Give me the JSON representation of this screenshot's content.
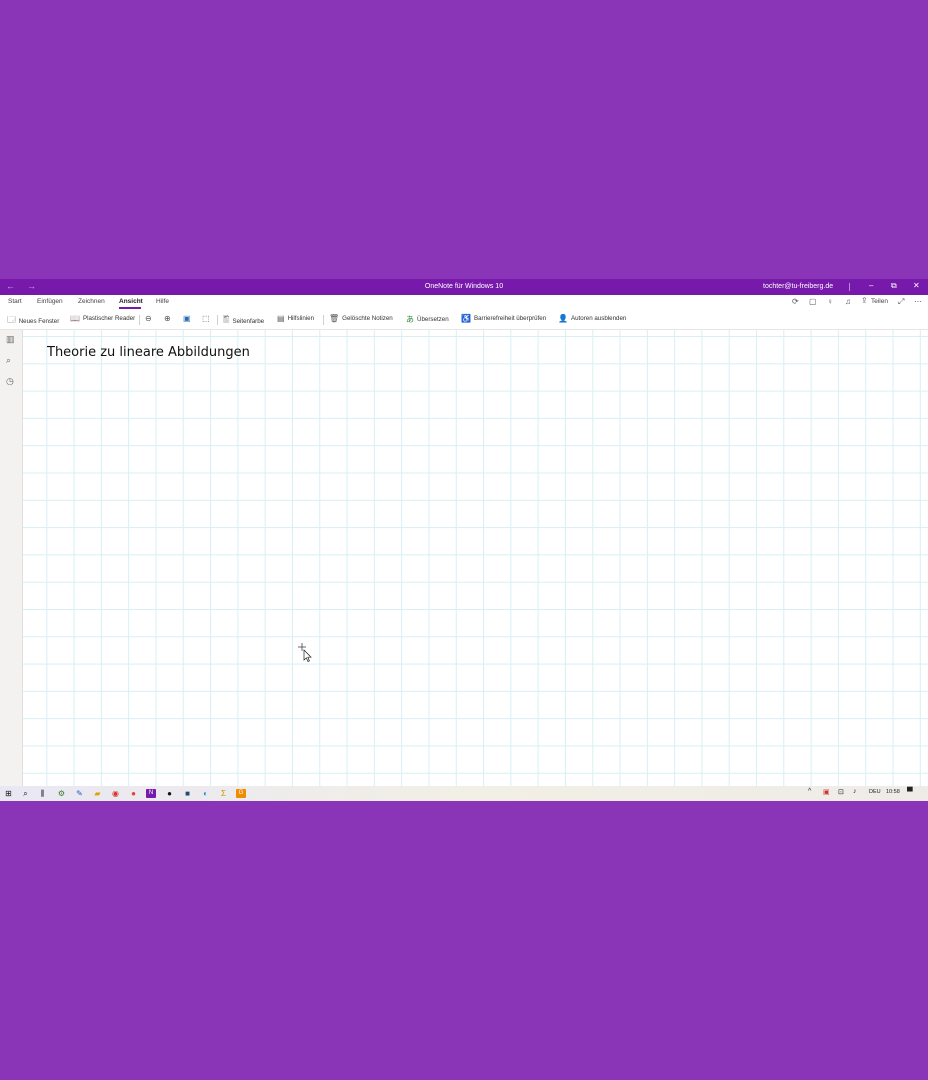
{
  "window": {
    "title": "OneNote für Windows 10",
    "account": "tochter@tu-freiberg.de",
    "back_glyph": "←",
    "forward_glyph": "→",
    "minimize_glyph": "–",
    "restore_glyph": "⧉",
    "close_glyph": "✕"
  },
  "ribbon_tabs": [
    {
      "label": "Start"
    },
    {
      "label": "Einfügen"
    },
    {
      "label": "Zeichnen"
    },
    {
      "label": "Ansicht",
      "active": true
    },
    {
      "label": "Hilfe"
    }
  ],
  "ribbon_right": {
    "share_label": "Teilen",
    "icons": [
      "sync-icon",
      "notebook-icon",
      "lightbulb-icon",
      "bell-icon",
      "share-icon",
      "expand-icon",
      "more-icon"
    ]
  },
  "toolbar": {
    "new_window": "Neues Fenster",
    "immersive_reader": "Plastischer Reader",
    "page_color": "Seitenfarbe",
    "rule_lines": "Hilfslinien",
    "deleted_notes": "Gelöschte Notizen",
    "translate": "Übersetzen",
    "accessibility_check": "Barrierefreiheit überprüfen",
    "hide_authors": "Autoren ausblenden"
  },
  "page": {
    "title": "Theorie zu lineare Abbildungen"
  },
  "taskbar": {
    "language": "DEU",
    "time": "10:58"
  },
  "colors": {
    "accent": "#7719aa",
    "desktop": "#8a35b8",
    "grid": "#d6f0f4"
  }
}
